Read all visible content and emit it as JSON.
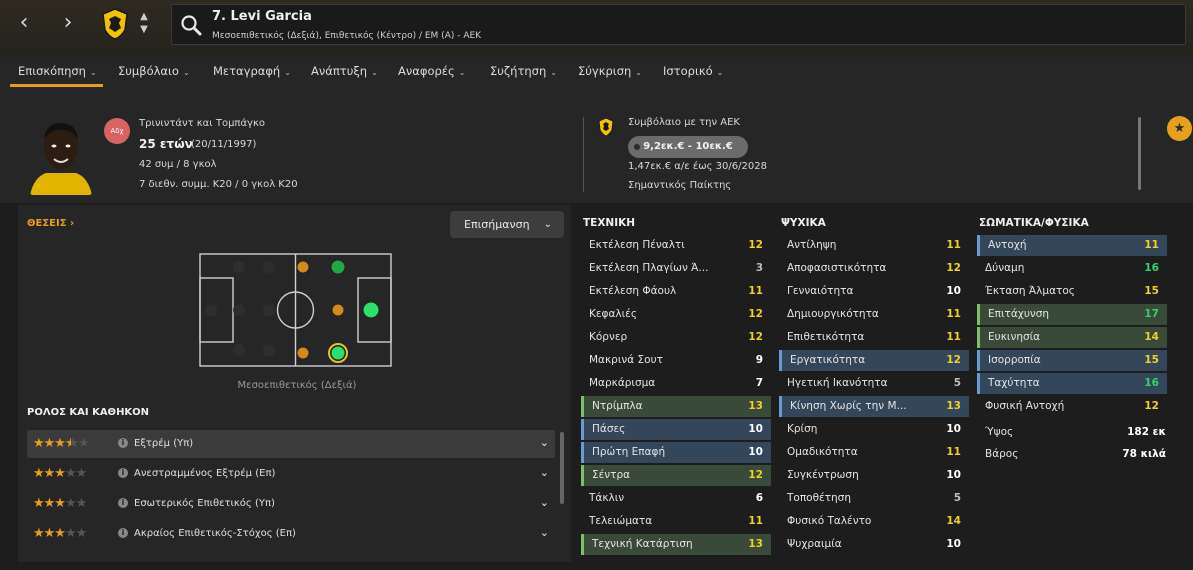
{
  "header": {
    "player_name": "7. Levi Garcia",
    "player_subtitle": "Μεσοεπιθετικός (Δεξιά), Επιθετικός (Κέντρο) / ΕΜ (Α) - ΑΕΚ"
  },
  "tabs": [
    {
      "label": "Επισκόπηση"
    },
    {
      "label": "Συμβόλαιο"
    },
    {
      "label": "Μεταγραφή"
    },
    {
      "label": "Ανάπτυξη"
    },
    {
      "label": "Αναφορές"
    },
    {
      "label": "Συζήτηση"
    },
    {
      "label": "Σύγκριση"
    },
    {
      "label": "Ιστορικό"
    }
  ],
  "profile": {
    "nationality_badge": "Αδχ",
    "nationality": "Τρινιντάντ και Τομπάγκο",
    "age": "25 ετών",
    "dob": "(20/11/1997)",
    "caps": "42 συμ / 8 γκολ",
    "u20": "7 διεθν. συμμ. Κ20 / 0 γκολ Κ20"
  },
  "contract": {
    "title": "Συμβόλαιο με την ΑΕΚ",
    "wage": "9,2εκ.€ - 10εκ.€",
    "terms": "1,47εκ.€ α/ε έως 30/6/2028",
    "status": "Σημαντικός Παίκτης"
  },
  "positions": {
    "label": "ΘΕΣΕΙΣ",
    "highlight": "Επισήμανση",
    "caption": "Μεσοεπιθετικός (Δεξιά)",
    "colors": {
      "pitch_line": "#cfcfcf",
      "natural": "#2ce06a",
      "accomplished": "#1fa843",
      "unconvincing": "#d18a1b"
    }
  },
  "roles": {
    "title": "ΡΟΛΟΣ ΚΑΙ ΚΑΘΗΚΟΝ",
    "items": [
      {
        "name": "Εξτρέμ (Υπ)",
        "stars": 3.5
      },
      {
        "name": "Ανεστραμμένος Εξτρέμ (Επ)",
        "stars": 3
      },
      {
        "name": "Εσωτερικός Επιθετικός (Υπ)",
        "stars": 3
      },
      {
        "name": "Ακραίος Επιθετικός-Στόχος (Επ)",
        "stars": 3
      }
    ]
  },
  "technical": {
    "title": "ΤΕΧΝΙΚΗ",
    "items": [
      {
        "name": "Εκτέλεση Πέναλτι",
        "value": "12"
      },
      {
        "name": "Εκτέλεση Πλαγίων Ά...",
        "value": "3"
      },
      {
        "name": "Εκτέλεση Φάουλ",
        "value": "11"
      },
      {
        "name": "Κεφαλιές",
        "value": "12"
      },
      {
        "name": "Κόρνερ",
        "value": "12"
      },
      {
        "name": "Μακρινά Σουτ",
        "value": "9"
      },
      {
        "name": "Μαρκάρισμα",
        "value": "7"
      },
      {
        "name": "Ντρίμπλα",
        "value": "13"
      },
      {
        "name": "Πάσες",
        "value": "10"
      },
      {
        "name": "Πρώτη Επαφή",
        "value": "10"
      },
      {
        "name": "Σέντρα",
        "value": "12"
      },
      {
        "name": "Τάκλιν",
        "value": "6"
      },
      {
        "name": "Τελειώματα",
        "value": "11"
      },
      {
        "name": "Τεχνική Κατάρτιση",
        "value": "13"
      }
    ]
  },
  "mental": {
    "title": "ΨΥΧΙΚΑ",
    "items": [
      {
        "name": "Αντίληψη",
        "value": "11"
      },
      {
        "name": "Αποφασιστικότητα",
        "value": "12"
      },
      {
        "name": "Γενναιότητα",
        "value": "10"
      },
      {
        "name": "Δημιουργικότητα",
        "value": "11"
      },
      {
        "name": "Επιθετικότητα",
        "value": "11"
      },
      {
        "name": "Εργατικότητα",
        "value": "12"
      },
      {
        "name": "Ηγετική Ικανότητα",
        "value": "5"
      },
      {
        "name": "Κίνηση Χωρίς την Μ...",
        "value": "13"
      },
      {
        "name": "Κρίση",
        "value": "10"
      },
      {
        "name": "Ομαδικότητα",
        "value": "11"
      },
      {
        "name": "Συγκέντρωση",
        "value": "10"
      },
      {
        "name": "Τοποθέτηση",
        "value": "5"
      },
      {
        "name": "Φυσικό Ταλέντο",
        "value": "14"
      },
      {
        "name": "Ψυχραιμία",
        "value": "10"
      }
    ]
  },
  "physical": {
    "title": "ΣΩΜΑΤΙΚΑ/ΦΥΣΙΚΑ",
    "items": [
      {
        "name": "Αντοχή",
        "value": "11"
      },
      {
        "name": "Δύναμη",
        "value": "16"
      },
      {
        "name": "Έκταση Άλματος",
        "value": "15"
      },
      {
        "name": "Επιτάχυνση",
        "value": "17"
      },
      {
        "name": "Ευκινησία",
        "value": "14"
      },
      {
        "name": "Ισορροπία",
        "value": "15"
      },
      {
        "name": "Ταχύτητα",
        "value": "16"
      },
      {
        "name": "Φυσική Αντοχή",
        "value": "12"
      }
    ]
  },
  "bio": {
    "height_label": "Ύψος",
    "height": "182 εκ",
    "weight_label": "Βάρος",
    "weight": "78 κιλά"
  },
  "colors": {
    "accent": "#e6a01e",
    "value_yellow": "#f1d02c",
    "value_green": "#33d46a",
    "blue_highlight": "#34475a",
    "green_highlight": "#3a4a39"
  }
}
